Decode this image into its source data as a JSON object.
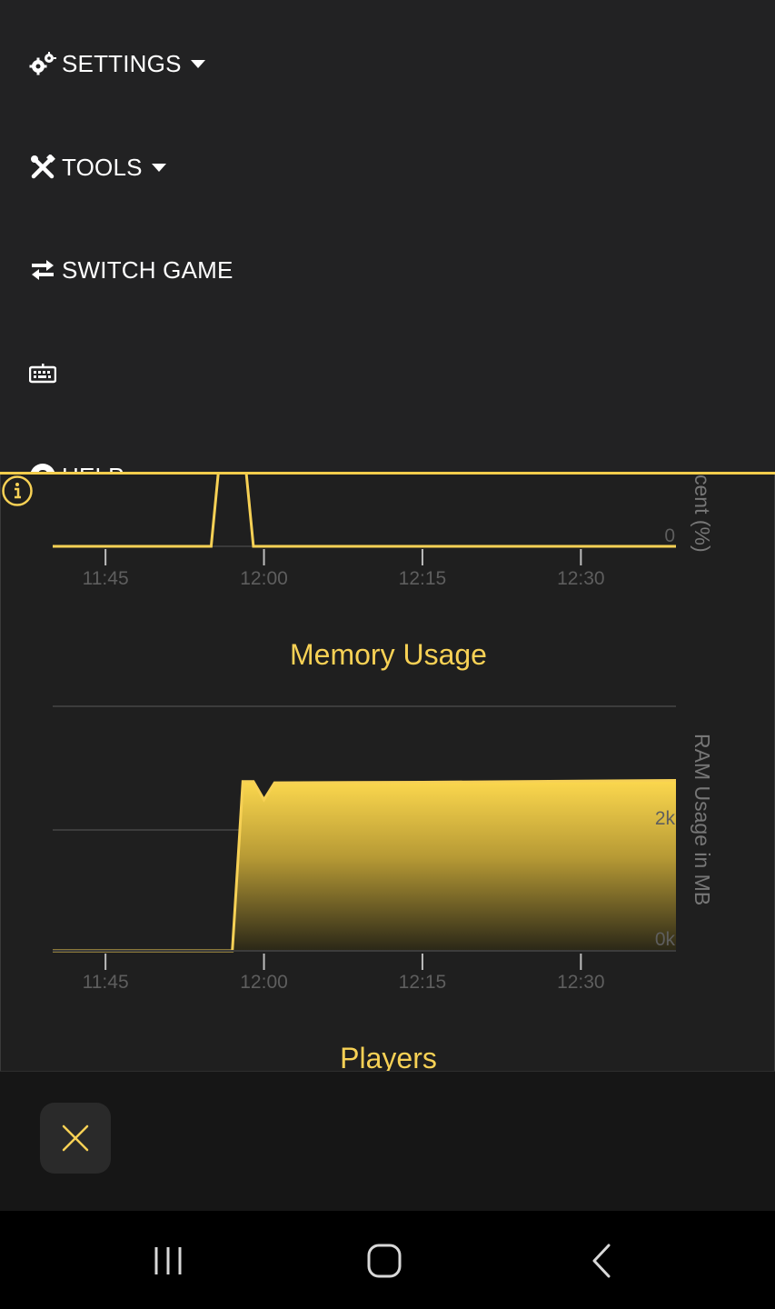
{
  "menu": {
    "items": [
      {
        "icon": "gears-icon",
        "label": "SETTINGS",
        "has_dropdown": true
      },
      {
        "icon": "tools-icon",
        "label": "TOOLS",
        "has_dropdown": true
      },
      {
        "icon": "switch-arrows-icon",
        "label": "SWITCH GAME",
        "has_dropdown": false
      },
      {
        "icon": "keyboard-icon",
        "label": "",
        "has_dropdown": false
      },
      {
        "icon": "help-icon",
        "label": "HELP",
        "has_dropdown": false
      }
    ]
  },
  "accent_color": "#f7d155",
  "cpu_chart": {
    "ylabel": "cent (%)",
    "y_tick": "0",
    "x_ticks": [
      "11:45",
      "12:00",
      "12:15",
      "12:30"
    ]
  },
  "memory_chart": {
    "title": "Memory Usage",
    "ylabel": "RAM Usage in MB",
    "y_ticks": [
      "2k",
      "0k"
    ],
    "x_ticks": [
      "11:45",
      "12:00",
      "12:15",
      "12:30"
    ]
  },
  "players_chart": {
    "title": "Players"
  },
  "chart_data": [
    {
      "type": "line",
      "title": "",
      "xlabel": "",
      "ylabel": "cent (%)",
      "x": [
        "11:40",
        "11:55",
        "11:56",
        "11:58",
        "11:59",
        "12:00",
        "12:39"
      ],
      "values": [
        0,
        0,
        100,
        100,
        0,
        0,
        0
      ],
      "xlim": [
        "11:40",
        "12:39"
      ]
    },
    {
      "type": "area",
      "title": "Memory Usage",
      "xlabel": "",
      "ylabel": "RAM Usage in MB",
      "x": [
        "11:40",
        "11:57",
        "11:58",
        "11:59",
        "12:00",
        "12:01",
        "12:15",
        "12:39"
      ],
      "values": [
        0,
        0,
        2800,
        2800,
        2500,
        2780,
        2790,
        2820
      ],
      "ylim": [
        0,
        4000
      ],
      "xlim": [
        "11:40",
        "12:39"
      ]
    }
  ],
  "bottom_bar": {
    "close_icon": "close-icon"
  },
  "nav_bar": {
    "recents": "recents-icon",
    "home": "home-icon",
    "back": "back-icon"
  }
}
